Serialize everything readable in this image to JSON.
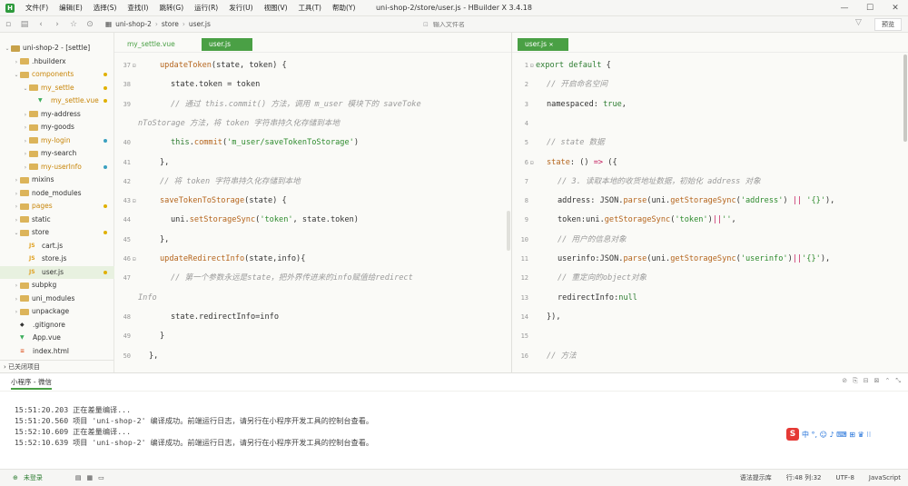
{
  "window": {
    "title": "uni-shop-2/store/user.js - HBuilder X 3.4.18",
    "menu": [
      "文件(F)",
      "编辑(E)",
      "选择(S)",
      "查找(I)",
      "跳转(G)",
      "运行(R)",
      "发行(U)",
      "视图(V)",
      "工具(T)",
      "帮助(Y)"
    ]
  },
  "toolbar": {
    "breadcrumb": [
      "uni-shop-2",
      "store",
      "user.js"
    ],
    "search_placeholder": "输入文件名",
    "preview_label": "预览"
  },
  "sidebar": {
    "items": [
      {
        "label": "uni-shop-2 - [settle]",
        "level": 0,
        "type": "root",
        "open": true
      },
      {
        "label": ".hbuilderx",
        "level": 1,
        "type": "folder",
        "open": false
      },
      {
        "label": "components",
        "level": 1,
        "type": "folder",
        "open": true,
        "accent": true,
        "dot": "#e0b000"
      },
      {
        "label": "my_settle",
        "level": 2,
        "type": "folder",
        "open": true,
        "accent": true,
        "dot": "#e0b000"
      },
      {
        "label": "my_settle.vue",
        "level": 3,
        "type": "vue",
        "accent": true,
        "dot": "#e0b000"
      },
      {
        "label": "my-address",
        "level": 2,
        "type": "folder",
        "open": false
      },
      {
        "label": "my-goods",
        "level": 2,
        "type": "folder",
        "open": false
      },
      {
        "label": "my-login",
        "level": 2,
        "type": "folder",
        "open": false,
        "accent": true,
        "dot": "#3aa0c0"
      },
      {
        "label": "my-search",
        "level": 2,
        "type": "folder",
        "open": false
      },
      {
        "label": "my-userInfo",
        "level": 2,
        "type": "folder",
        "open": false,
        "accent": true,
        "dot": "#3aa0c0"
      },
      {
        "label": "mixins",
        "level": 1,
        "type": "folder",
        "open": false
      },
      {
        "label": "node_modules",
        "level": 1,
        "type": "folder",
        "open": false
      },
      {
        "label": "pages",
        "level": 1,
        "type": "folder",
        "open": false,
        "accent": true,
        "dot": "#e0b000"
      },
      {
        "label": "static",
        "level": 1,
        "type": "folder",
        "open": false
      },
      {
        "label": "store",
        "level": 1,
        "type": "folder",
        "open": true,
        "dot": "#e0b000"
      },
      {
        "label": "cart.js",
        "level": 2,
        "type": "js"
      },
      {
        "label": "store.js",
        "level": 2,
        "type": "js"
      },
      {
        "label": "user.js",
        "level": 2,
        "type": "js",
        "selected": true,
        "dot": "#e0b000"
      },
      {
        "label": "subpkg",
        "level": 1,
        "type": "folder",
        "open": false
      },
      {
        "label": "uni_modules",
        "level": 1,
        "type": "folder",
        "open": false
      },
      {
        "label": "unpackage",
        "level": 1,
        "type": "folder",
        "open": false
      },
      {
        "label": ".gitignore",
        "level": 1,
        "type": "git"
      },
      {
        "label": "App.vue",
        "level": 1,
        "type": "vue"
      },
      {
        "label": "index.html",
        "level": 1,
        "type": "html"
      }
    ],
    "closed_projects": "已关闭项目"
  },
  "left_editor": {
    "tabs": [
      {
        "label": "my_settle.vue",
        "active": false
      },
      {
        "label": "user.js",
        "active": true
      }
    ],
    "lines": [
      {
        "n": "37",
        "fold": true,
        "indent": 2,
        "html": "<span class='fn'>updateToken</span>(state, token) {"
      },
      {
        "n": "38",
        "indent": 3,
        "html": "state.token = token"
      },
      {
        "n": "39",
        "indent": 3,
        "html": "<span class='cmt'>// 通过 this.commit() 方法，调用 m_user 模块下的 saveToke</span>"
      },
      {
        "n": "",
        "indent": 0,
        "html": "<span class='cmt'>nToStorage 方法，将 token 字符串持久化存储到本地</span>"
      },
      {
        "n": "40",
        "indent": 3,
        "html": "<span class='kw'>this</span>.<span class='fn'>commit</span>(<span class='str'>'m_user/saveTokenToStorage'</span>)"
      },
      {
        "n": "41",
        "indent": 2,
        "html": "},"
      },
      {
        "n": "42",
        "indent": 2,
        "html": "<span class='cmt'>// 将 token 字符串持久化存储到本地</span>"
      },
      {
        "n": "43",
        "fold": true,
        "indent": 2,
        "html": "<span class='fn'>saveTokenToStorage</span>(state) {"
      },
      {
        "n": "44",
        "indent": 3,
        "html": "uni.<span class='fn'>setStorageSync</span>(<span class='str'>'token'</span>, state.token)"
      },
      {
        "n": "45",
        "indent": 2,
        "html": "},"
      },
      {
        "n": "46",
        "fold": true,
        "indent": 2,
        "html": "<span class='fn'>updateRedirectInfo</span>(state,info){"
      },
      {
        "n": "47",
        "indent": 3,
        "html": "<span class='cmt'>// 第一个参数永远是state，把外界传进来的info赋值给redirect</span>"
      },
      {
        "n": "",
        "indent": 0,
        "html": "<span class='cmt'>Info</span>"
      },
      {
        "n": "48",
        "indent": 3,
        "html": "state.redirectInfo=info"
      },
      {
        "n": "49",
        "indent": 2,
        "html": "}"
      },
      {
        "n": "50",
        "indent": 1,
        "html": "},"
      }
    ]
  },
  "right_editor": {
    "tabs": [
      {
        "label": "user.js",
        "active": true
      }
    ],
    "lines": [
      {
        "n": "1",
        "fold": true,
        "indent": 0,
        "html": "<span class='kw'>export default</span> {"
      },
      {
        "n": "2",
        "indent": 1,
        "html": "<span class='cmt'>// 开启命名空间</span>"
      },
      {
        "n": "3",
        "indent": 1,
        "html": "namespaced: <span class='kw'>true</span>,"
      },
      {
        "n": "4",
        "indent": 0,
        "html": ""
      },
      {
        "n": "5",
        "indent": 1,
        "html": "<span class='cmt'>// state 数据</span>"
      },
      {
        "n": "6",
        "fold": true,
        "indent": 1,
        "html": "<span class='fn'>state</span>: () <span class='op'>=&gt;</span> ({"
      },
      {
        "n": "7",
        "indent": 2,
        "html": "<span class='cmt'>// 3. 读取本地的收货地址数据，初始化 address 对象</span>"
      },
      {
        "n": "8",
        "indent": 2,
        "html": "address: JSON.<span class='fn'>parse</span>(uni.<span class='fn'>getStorageSync</span>(<span class='str'>'address'</span>) <span class='op'>||</span> <span class='str'>'{}'</span>),"
      },
      {
        "n": "9",
        "indent": 2,
        "html": "token:uni.<span class='fn'>getStorageSync</span>(<span class='str'>'token'</span>)<span class='op'>||</span><span class='str'>''</span>,"
      },
      {
        "n": "10",
        "indent": 2,
        "html": "<span class='cmt'>// 用户的信息对象</span>"
      },
      {
        "n": "11",
        "indent": 2,
        "html": "userinfo:JSON.<span class='fn'>parse</span>(uni.<span class='fn'>getStorageSync</span>(<span class='str'>'userinfo'</span>)<span class='op'>||</span><span class='str'>'{}'</span>),"
      },
      {
        "n": "12",
        "indent": 2,
        "html": "<span class='cmt'>// 重定向的object对象</span>"
      },
      {
        "n": "13",
        "indent": 2,
        "html": "redirectInfo:<span class='kw'>null</span>"
      },
      {
        "n": "14",
        "indent": 1,
        "html": "}),"
      },
      {
        "n": "15",
        "indent": 0,
        "html": ""
      },
      {
        "n": "16",
        "indent": 1,
        "html": "<span class='cmt'>// 方法</span>"
      }
    ]
  },
  "output": {
    "title": "小程序 - 微信",
    "logs": [
      "15:51:20.203 正在差量编译...",
      "15:51:20.560 项目 'uni-shop-2' 编译成功。前端运行日志，请另行在小程序开发工具的控制台查看。",
      "15:52:10.609 正在差量编译...",
      "15:52:10.639 项目 'uni-shop-2' 编译成功。前端运行日志，请另行在小程序开发工具的控制台查看。"
    ]
  },
  "ime": {
    "glyphs": "中 °, ☺ ♪ ⌨ ⊞ ♛ ⁝⁝"
  },
  "statusbar": {
    "login": "未登录",
    "hint": "语法提示库",
    "position": "行:48  列:32",
    "encoding": "UTF-8",
    "language": "JavaScript"
  }
}
